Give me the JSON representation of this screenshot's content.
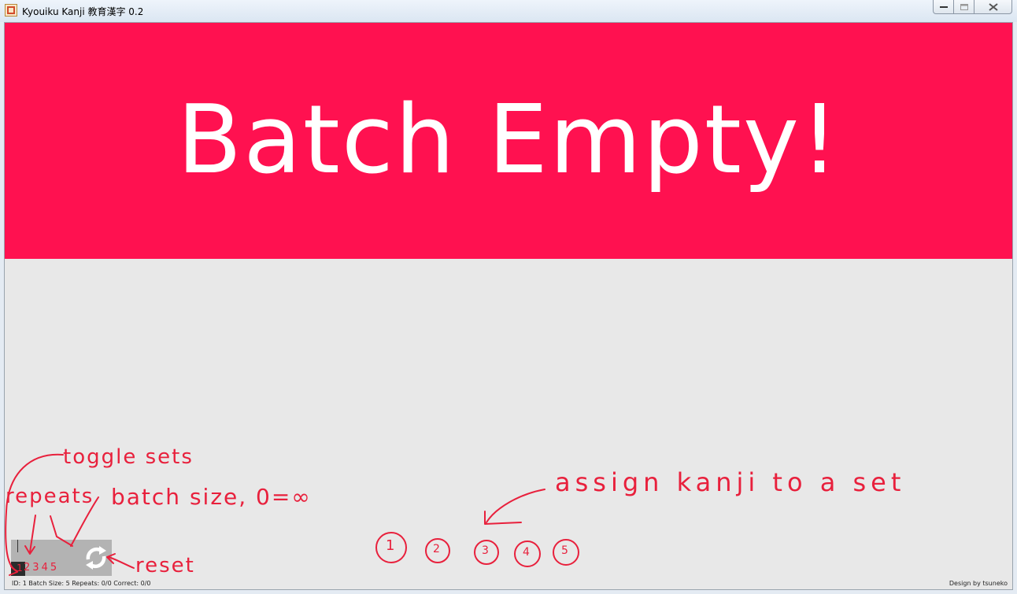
{
  "window": {
    "title": "Kyouiku Kanji 教育漢字 0.2"
  },
  "banner": {
    "text": "Batch Empty!",
    "background": "#ff1150",
    "text_color": "#ffffff"
  },
  "controls": {
    "set_toggle_labels": [
      "1",
      "2",
      "3",
      "4",
      "5"
    ],
    "reset_icon": "refresh-icon"
  },
  "status": {
    "line": "ID: 1 Batch Size: 5 Repeats: 0/0 Correct: 0/0",
    "credit": "Design by tsuneko"
  },
  "annotations": {
    "toggle_sets": "toggle sets",
    "repeats": "repeats",
    "batch_size": "batch size, 0=∞",
    "reset": "reset",
    "assign": "assign kanji to a set",
    "set_circles": [
      "1",
      "2",
      "3",
      "4",
      "5"
    ],
    "color": "#e8203c"
  }
}
